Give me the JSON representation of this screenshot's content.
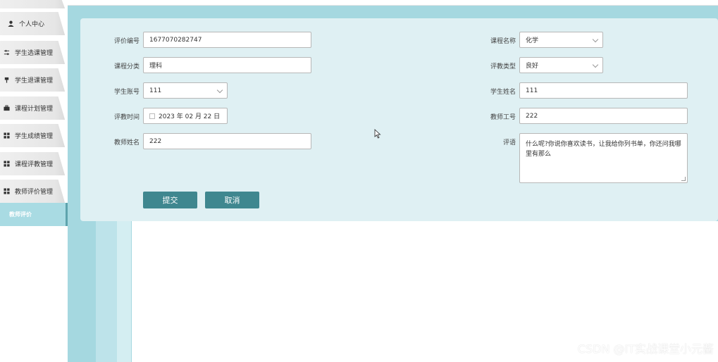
{
  "sidebar": {
    "items": [
      {
        "label": "",
        "icon": "blank"
      },
      {
        "label": "个人中心",
        "icon": "user-icon"
      },
      {
        "label": "学生选课管理",
        "icon": "sliders-icon"
      },
      {
        "label": "学生退课管理",
        "icon": "pin-icon"
      },
      {
        "label": "课程计划管理",
        "icon": "briefcase-icon"
      },
      {
        "label": "学生成绩管理",
        "icon": "grid-icon"
      },
      {
        "label": "课程评教管理",
        "icon": "grid-icon"
      },
      {
        "label": "教师评价管理",
        "icon": "grid-icon"
      },
      {
        "label": "教师评价",
        "icon": "none"
      }
    ]
  },
  "form": {
    "eval_no": {
      "label": "评价编号",
      "value": "1677070282747"
    },
    "course_category": {
      "label": "课程分类",
      "value": "理科"
    },
    "student_account": {
      "label": "学生账号",
      "value": "111"
    },
    "eval_time": {
      "label": "评教时间",
      "value": "2023 年 02 月 22 日"
    },
    "teacher_name": {
      "label": "教师姓名",
      "value": "222"
    },
    "course_name": {
      "label": "课程名称",
      "value": "化学"
    },
    "eval_type": {
      "label": "评教类型",
      "value": "良好"
    },
    "student_name": {
      "label": "学生姓名",
      "value": "111"
    },
    "teacher_id": {
      "label": "教师工号",
      "value": "222"
    },
    "comment": {
      "label": "评语",
      "value": "什么呢?你说你喜欢读书，让我给你列书单，你还问我哪里有那么"
    }
  },
  "buttons": {
    "submit": "提交",
    "cancel": "取消"
  },
  "watermark": "CSDN @IT实战课堂小元酱",
  "colors": {
    "accent": "#3f878f",
    "background": "#a5d8e0",
    "card": "#dff0f3"
  }
}
